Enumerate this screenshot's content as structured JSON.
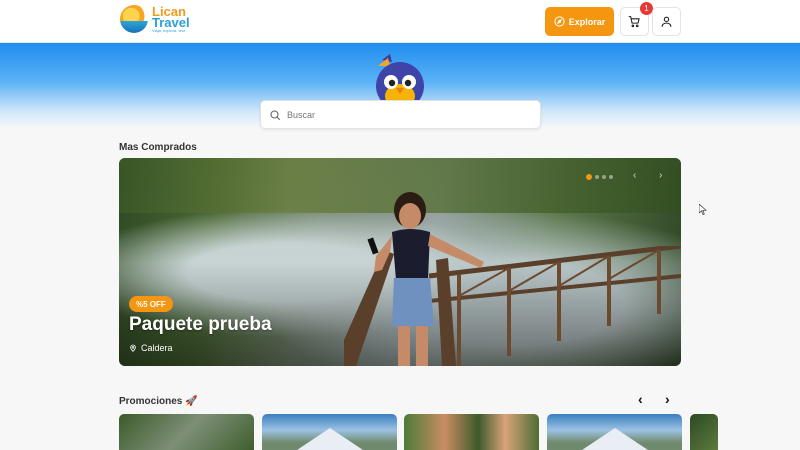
{
  "header": {
    "logo": {
      "line1": "Lican",
      "line2": "Travel",
      "tagline": "Viaja, explora, vive"
    },
    "explore_label": "Explorar",
    "cart_count": "1"
  },
  "search": {
    "placeholder": "Buscar",
    "value": ""
  },
  "sections": {
    "most_bought": "Mas Comprados",
    "promotions": "Promociones 🚀"
  },
  "featured": {
    "discount": "%5 OFF",
    "title": "Paquete prueba",
    "location": "Caldera",
    "dots": 4,
    "active_dot": 0
  },
  "colors": {
    "accent": "#f4960f",
    "badge": "#e53935",
    "brand_blue": "#2aa0d6"
  },
  "icons": [
    "compass-icon",
    "cart-icon",
    "user-icon",
    "search-icon",
    "location-pin-icon",
    "chevron-left-icon",
    "chevron-right-icon"
  ]
}
